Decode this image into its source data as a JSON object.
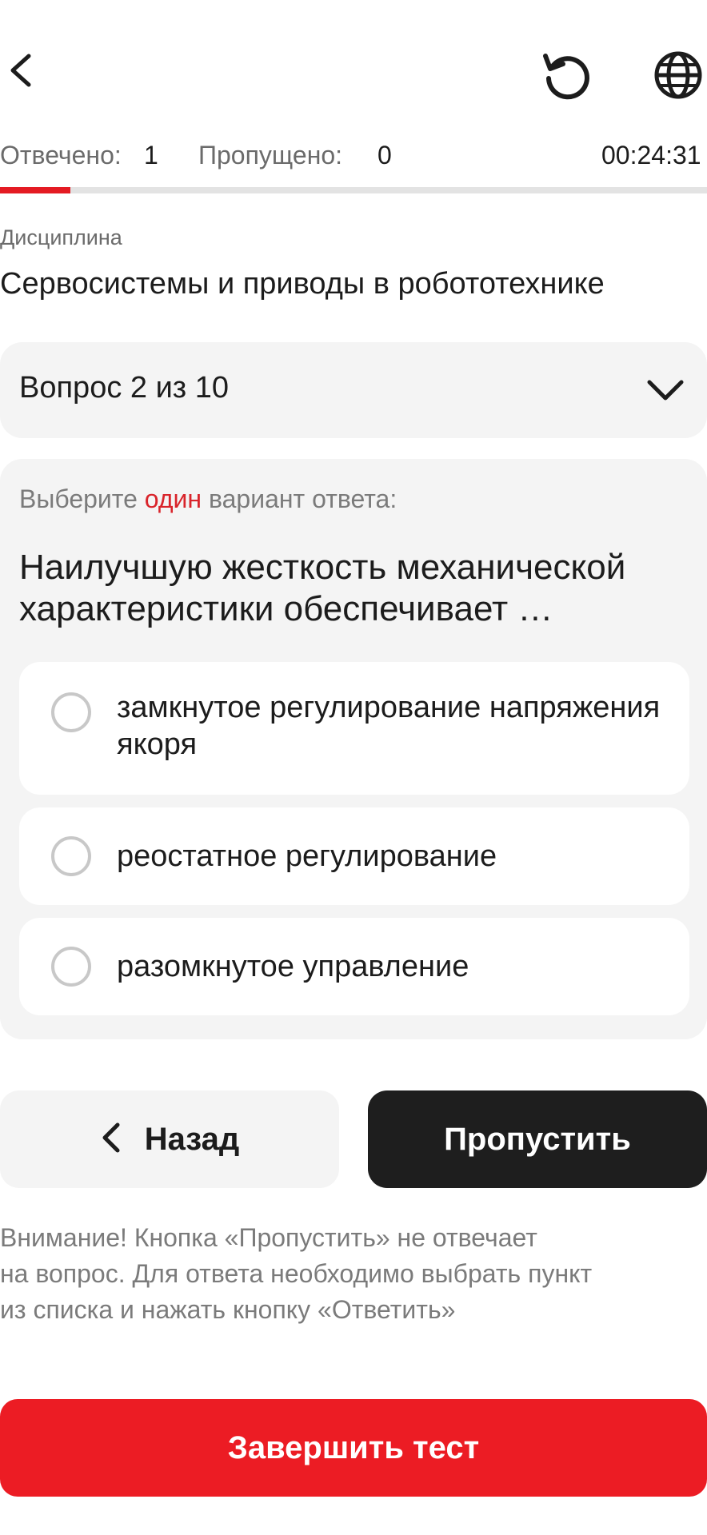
{
  "header": {
    "icons": [
      "chevron-left-icon",
      "reset-icon",
      "globe-icon"
    ]
  },
  "stats": {
    "answered_label": "Отвечено:",
    "answered_value": "1",
    "skipped_label": "Пропущено:",
    "skipped_value": "0",
    "timer": "00:24:31"
  },
  "progress": {
    "fraction": 0.1
  },
  "discipline": {
    "label": "Дисциплина",
    "title": "Сервосистемы и приводы в робототехнике"
  },
  "question_selector": {
    "label": "Вопрос 2 из 10"
  },
  "question": {
    "instruction_before": "Выберите",
    "instruction_accent": "один",
    "instruction_after": "вариант ответа:",
    "text": "Наилучшую жесткость механической характеристики обеспечивает …",
    "options": [
      {
        "text": "замкнутое регулирование напряжения якоря",
        "selected": false
      },
      {
        "text": "реостатное регулирование",
        "selected": false
      },
      {
        "text": "разомкнутое управление",
        "selected": false
      }
    ]
  },
  "buttons": {
    "back": "Назад",
    "skip": "Пропустить",
    "finish": "Завершить тест"
  },
  "notice": {
    "line1": "Внимание! Кнопка «Пропустить» не отвечает",
    "line2": "на вопрос. Для ответа необходимо выбрать пункт",
    "line3": "из списка и нажать кнопку «Ответить»"
  },
  "colors": {
    "accent": "#e41b23",
    "finish_button": "#ec1c24",
    "skip_button": "#1e1e1e",
    "card_background": "#f4f4f4"
  }
}
